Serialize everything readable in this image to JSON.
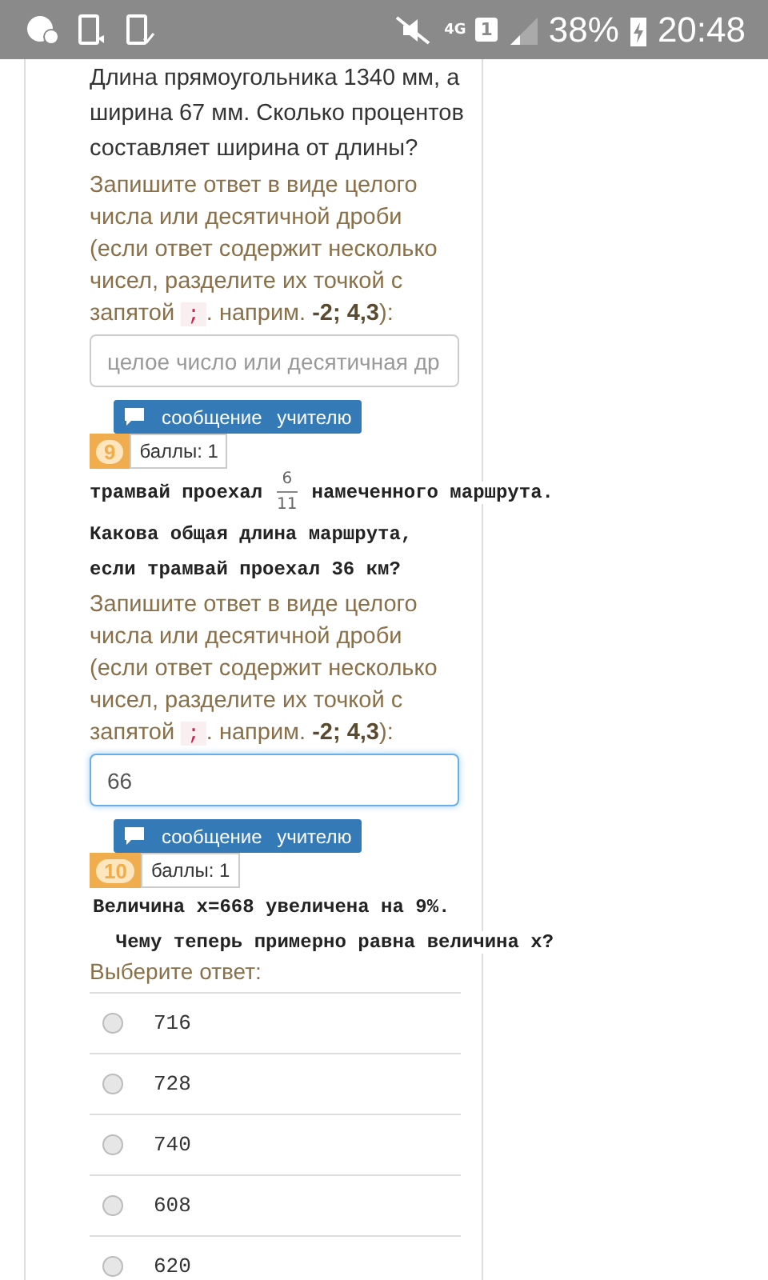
{
  "status_bar": {
    "network": "4G",
    "sim": "1",
    "battery": "38%",
    "time": "20:48"
  },
  "questions": [
    {
      "kind": "input",
      "text_lines": [
        "Длина прямоугольника 1340 мм, а ширина 67 мм. Сколько процентов составляет ширина от длины?"
      ],
      "hint_before": "Запишите ответ в виде целого числа или десятичной дроби (если ответ содержит несколько чисел, разделите их точкой с запятой",
      "hint_code": ";",
      "hint_after": ". наприм. **-2; 4,3**):",
      "placeholder": "целое число или десятичная др",
      "focused": false,
      "message": "сообщение учителю",
      "number": "9",
      "points": "баллы: 1"
    },
    {
      "kind": "input",
      "fraction_line": {
        "before": "трамвай проехал",
        "numerator": "6",
        "denominator": "11",
        "after": "намеченного маршрута."
      },
      "mono_lines": [
        "Какова общая длина маршрута,",
        "если трамвай проехал 36 км?"
      ],
      "hint_before": "Запишите ответ в виде целого числа или десятичной дроби (если ответ содержит несколько чисел, разделите их точкой с запятой",
      "hint_code": ";",
      "hint_after": ". наприм. **-2; 4,3**):",
      "value": "66",
      "focused": true,
      "message": "сообщение учителю",
      "number": "10",
      "points": "баллы: 1"
    },
    {
      "kind": "choice",
      "mono_lines": [
        "Величина x=668 увеличена на 9%.",
        "  Чему теперь примерно равна величина x?"
      ],
      "prompt": "Выберите ответ:",
      "options": [
        {
          "label": "716",
          "selected": false
        },
        {
          "label": "728",
          "selected": false
        },
        {
          "label": "740",
          "selected": false
        },
        {
          "label": "608",
          "selected": false
        },
        {
          "label": "620",
          "selected": false
        }
      ]
    }
  ]
}
